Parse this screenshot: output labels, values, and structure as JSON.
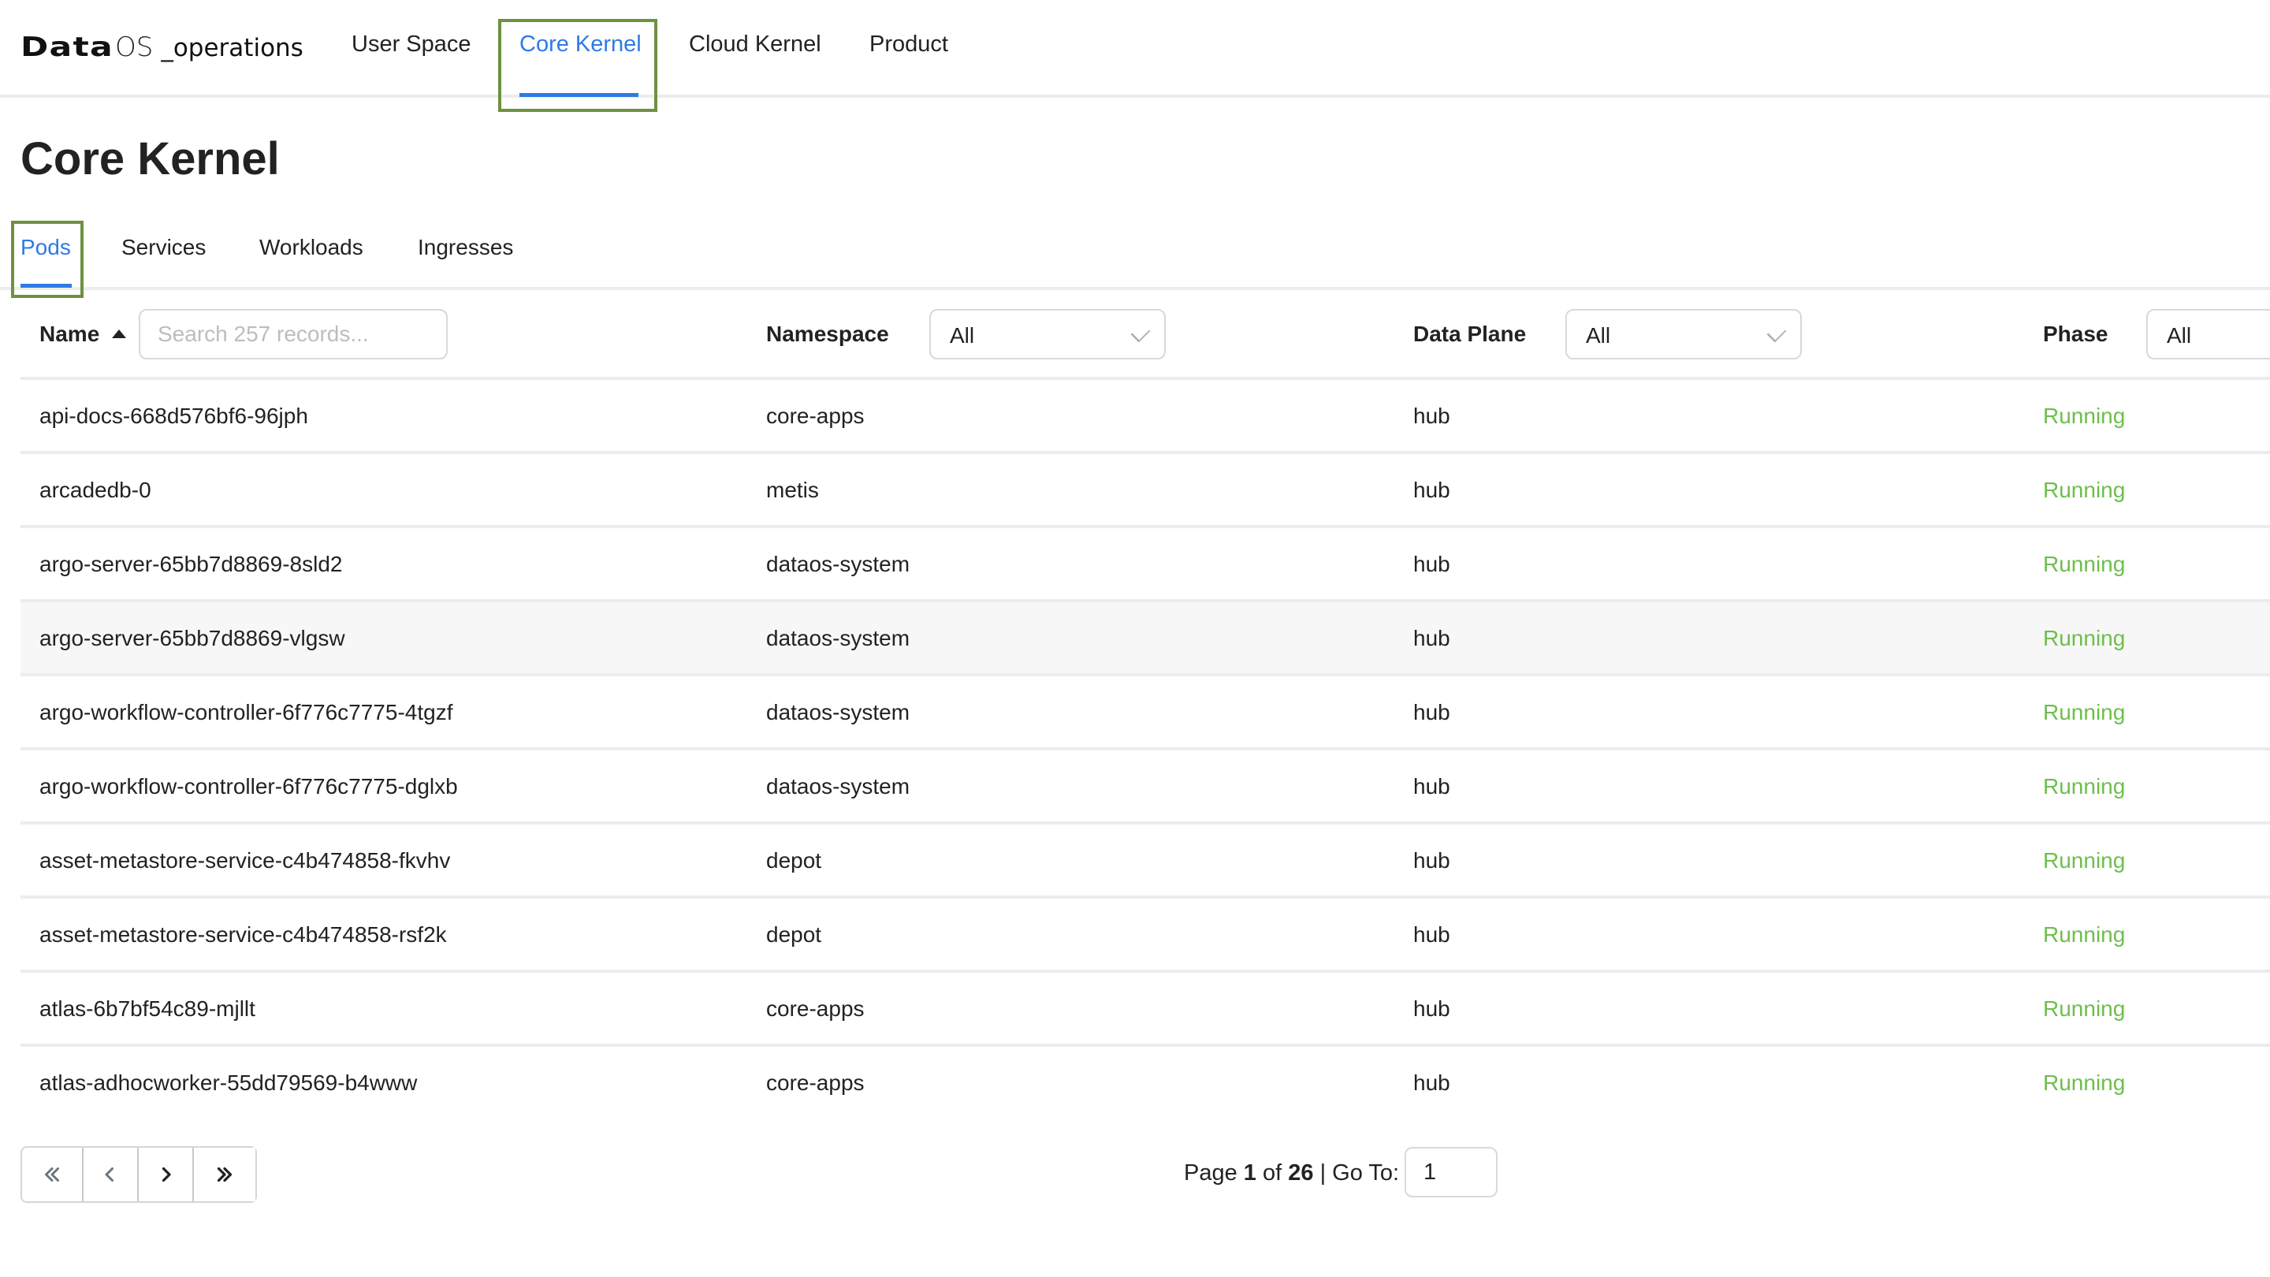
{
  "app": {
    "brand_bold": "Data",
    "brand_os": "OS",
    "brand_suffix": "_operations"
  },
  "nav": {
    "items": [
      {
        "label": "User Space",
        "active": false
      },
      {
        "label": "Core Kernel",
        "active": true
      },
      {
        "label": "Cloud Kernel",
        "active": false
      },
      {
        "label": "Product",
        "active": false
      }
    ]
  },
  "page": {
    "title": "Core Kernel"
  },
  "subtabs": {
    "items": [
      {
        "label": "Pods",
        "active": true
      },
      {
        "label": "Services",
        "active": false
      },
      {
        "label": "Workloads",
        "active": false
      },
      {
        "label": "Ingresses",
        "active": false
      }
    ]
  },
  "table": {
    "columns": {
      "name": "Name",
      "namespace": "Namespace",
      "data_plane": "Data Plane",
      "phase": "Phase"
    },
    "sort": {
      "column": "name",
      "direction": "ascending",
      "icon": "sort-ascending-icon"
    },
    "search": {
      "placeholder": "Search 257 records...",
      "value": ""
    },
    "filters": {
      "namespace": "All",
      "data_plane": "All",
      "phase": "All"
    },
    "rows": [
      {
        "name": "api-docs-668d576bf6-96jph",
        "namespace": "core-apps",
        "data_plane": "hub",
        "phase": "Running"
      },
      {
        "name": "arcadedb-0",
        "namespace": "metis",
        "data_plane": "hub",
        "phase": "Running"
      },
      {
        "name": "argo-server-65bb7d8869-8sld2",
        "namespace": "dataos-system",
        "data_plane": "hub",
        "phase": "Running"
      },
      {
        "name": "argo-server-65bb7d8869-vlgsw",
        "namespace": "dataos-system",
        "data_plane": "hub",
        "phase": "Running"
      },
      {
        "name": "argo-workflow-controller-6f776c7775-4tgzf",
        "namespace": "dataos-system",
        "data_plane": "hub",
        "phase": "Running"
      },
      {
        "name": "argo-workflow-controller-6f776c7775-dglxb",
        "namespace": "dataos-system",
        "data_plane": "hub",
        "phase": "Running"
      },
      {
        "name": "asset-metastore-service-c4b474858-fkvhv",
        "namespace": "depot",
        "data_plane": "hub",
        "phase": "Running"
      },
      {
        "name": "asset-metastore-service-c4b474858-rsf2k",
        "namespace": "depot",
        "data_plane": "hub",
        "phase": "Running"
      },
      {
        "name": "atlas-6b7bf54c89-mjllt",
        "namespace": "core-apps",
        "data_plane": "hub",
        "phase": "Running"
      },
      {
        "name": "atlas-adhocworker-55dd79569-b4www",
        "namespace": "core-apps",
        "data_plane": "hub",
        "phase": "Running"
      }
    ]
  },
  "pagination": {
    "buttons": [
      {
        "name": "first-page",
        "icon": "double-chevron-left-icon",
        "enabled": false
      },
      {
        "name": "previous-page",
        "icon": "chevron-left-icon",
        "enabled": false
      },
      {
        "name": "next-page",
        "icon": "chevron-right-icon",
        "enabled": true
      },
      {
        "name": "last-page",
        "icon": "double-chevron-right-icon",
        "enabled": true
      }
    ],
    "page_label": "Page",
    "current_page": "1",
    "of_label": "of",
    "total_pages": "26",
    "goto_label": "| Go To:",
    "goto_value": "1"
  },
  "colors": {
    "accent": "#2f7ae5",
    "running": "#6dbf4b",
    "highlight_box": "#6e9140",
    "hover_row": "#f7f7f7"
  }
}
